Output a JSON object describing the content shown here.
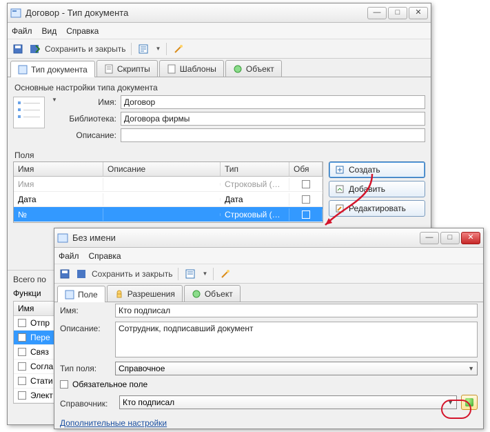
{
  "window1": {
    "title": "Договор - Тип документа",
    "menu": {
      "file": "Файл",
      "view": "Вид",
      "help": "Справка"
    },
    "toolbar": {
      "save_close": "Сохранить и закрыть"
    },
    "tabs": {
      "doc_type": "Тип документа",
      "scripts": "Скрипты",
      "templates": "Шаблоны",
      "object": "Объект"
    },
    "settings_label": "Основные настройки типа документа",
    "form": {
      "name_label": "Имя:",
      "name_value": "Договор",
      "library_label": "Библиотека:",
      "library_value": "Договора фирмы",
      "desc_label": "Описание:",
      "desc_value": ""
    },
    "fields_label": "Поля",
    "table": {
      "h_name": "Имя",
      "h_desc": "Описание",
      "h_type": "Тип",
      "h_req": "Обя",
      "rows": [
        {
          "name": "Имя",
          "desc": "",
          "type": "Строковый (Инд",
          "req": false
        },
        {
          "name": "Дата",
          "desc": "",
          "type": "Дата",
          "req": false
        },
        {
          "name": "№",
          "desc": "",
          "type": "Строковый (Инд",
          "req": false
        }
      ]
    },
    "buttons": {
      "create": "Создать",
      "add": "Добавить",
      "edit": "Редактировать"
    },
    "footer": {
      "total": "Всего по",
      "functions_label": "Функци",
      "h_name": "Имя"
    },
    "functions": {
      "items": [
        {
          "label": "Отпр",
          "sel": false
        },
        {
          "label": "Пере",
          "sel": true
        },
        {
          "label": "Связ",
          "sel": false
        },
        {
          "label": "Согла",
          "sel": false
        },
        {
          "label": "Стати",
          "sel": false
        },
        {
          "label": "Элект",
          "sel": false
        }
      ]
    }
  },
  "window2": {
    "title": "Без имени",
    "menu": {
      "file": "Файл",
      "help": "Справка"
    },
    "toolbar": {
      "save_close": "Сохранить и закрыть"
    },
    "tabs": {
      "field": "Поле",
      "permissions": "Разрешения",
      "object": "Объект"
    },
    "form": {
      "name_label": "Имя:",
      "name_value": "Кто подписал",
      "desc_label": "Описание:",
      "desc_value": "Сотрудник, подписавший документ",
      "type_label": "Тип поля:",
      "type_value": "Справочное",
      "required_label": "Обязательное поле",
      "ref_label": "Справочник:",
      "ref_value": "Кто подписал",
      "more_link": "Дополнительные настройки"
    }
  }
}
